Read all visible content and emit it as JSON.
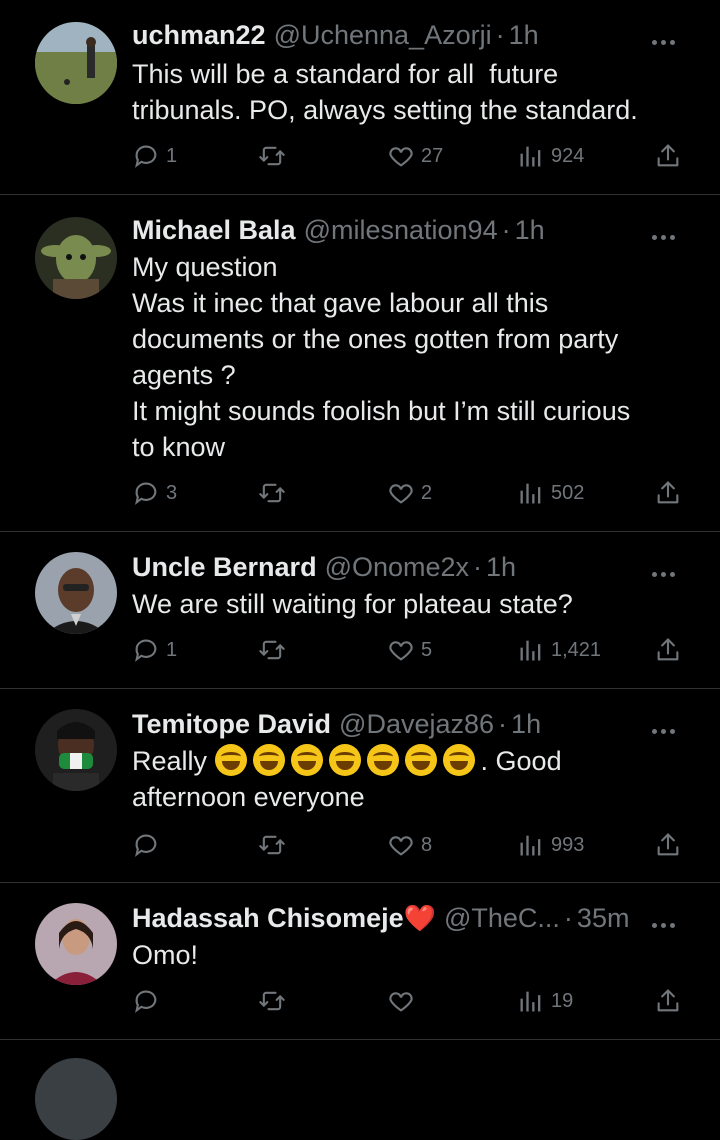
{
  "tweets": [
    {
      "name": "uchman22",
      "handle": "@Uchenna_Azorji",
      "time": "1h",
      "text": "This will be a standard for all  future\ntribunals. PO, always setting the standard.",
      "replies": "1",
      "retweets": "",
      "likes": "27",
      "views": "924"
    },
    {
      "name": "Michael Bala",
      "handle": "@milesnation94",
      "time": "1h",
      "text": "My question\nWas it inec that gave labour all this\ndocuments or the ones gotten from party\nagents ?\nIt might sounds foolish but I’m still curious\nto know",
      "replies": "3",
      "retweets": "",
      "likes": "2",
      "views": "502"
    },
    {
      "name": "Uncle Bernard",
      "handle": "@Onome2x",
      "time": "1h",
      "text": "We are still waiting for plateau state?",
      "replies": "1",
      "retweets": "",
      "likes": "5",
      "views": "1,421"
    },
    {
      "name": "Temitope David",
      "handle": "@Davejaz86",
      "time": "1h",
      "text_before": "Really ",
      "text_after": ". Good\nafternoon everyone",
      "emoji_count": 7,
      "replies": "",
      "retweets": "",
      "likes": "8",
      "views": "993"
    },
    {
      "name": "Hadassah Chisomeje",
      "name_emoji": "❤️",
      "handle": "@TheC...",
      "time": "35m",
      "text": "Omo!",
      "replies": "",
      "retweets": "",
      "likes": "",
      "views": "19"
    }
  ],
  "separator": "·",
  "icons": {
    "reply": "reply-icon",
    "retweet": "retweet-icon",
    "like": "heart-icon",
    "views": "views-icon",
    "share": "share-icon",
    "more": "more-icon"
  },
  "colors": {
    "background": "#000000",
    "text": "#e7e9ea",
    "muted": "#71767b",
    "divider": "#2f3336"
  }
}
